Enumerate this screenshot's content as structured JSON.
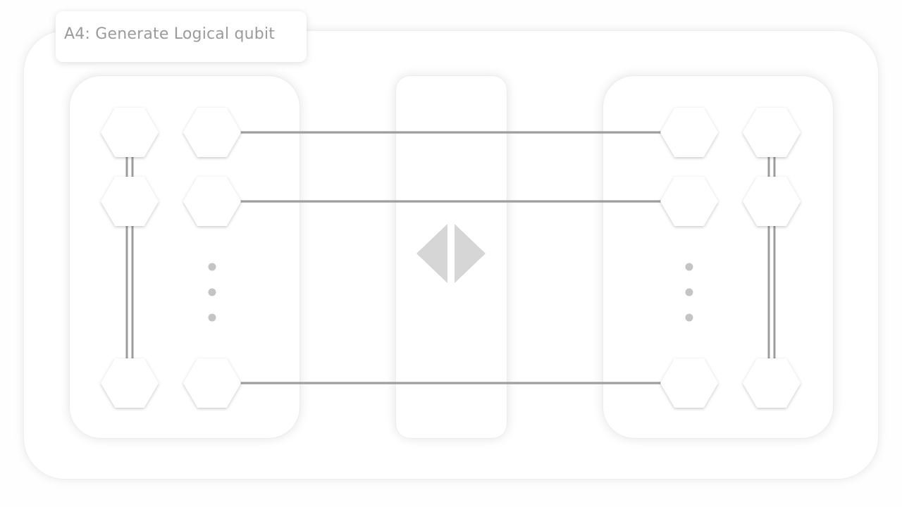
{
  "title": "A4: Generate Logical qubit",
  "colors": {
    "background": "#fefefe",
    "panel": "#ffffff",
    "hexagon_fill": "#ffffff",
    "connector": "#9e9e9e",
    "ellipsis_dot": "#c4c4c4",
    "center_glyph": "#d6d6d6",
    "title_text": "#9b9b9b"
  },
  "icons": {
    "center": "split-triangles-icon"
  },
  "diagram": {
    "left_block": {
      "columns": 2,
      "rows_shown": 3,
      "has_ellipsis": true
    },
    "right_block": {
      "columns": 2,
      "rows_shown": 3,
      "has_ellipsis": true
    },
    "horizontal_links": 3
  }
}
